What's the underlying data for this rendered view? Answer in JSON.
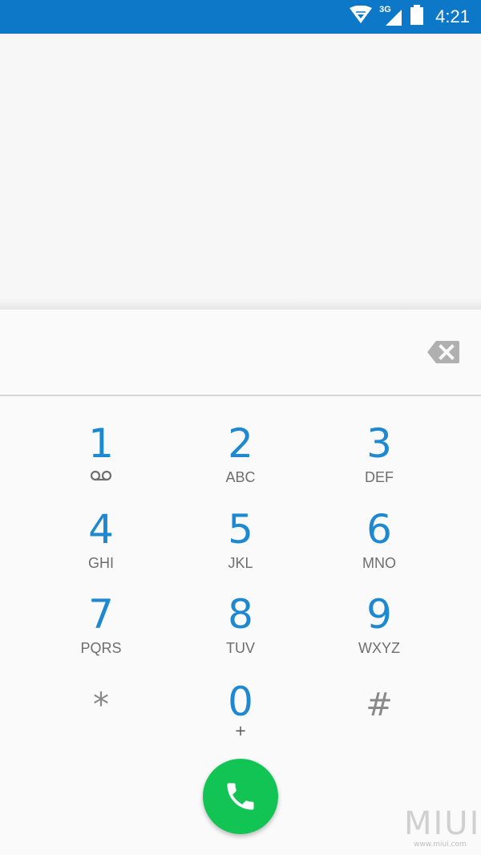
{
  "status_bar": {
    "network_type": "3G",
    "time": "4:21",
    "color": "#0d77c8"
  },
  "dialer": {
    "digits": "",
    "keys": [
      {
        "digit": "1",
        "letters": "",
        "icon": "voicemail-icon"
      },
      {
        "digit": "2",
        "letters": "ABC"
      },
      {
        "digit": "3",
        "letters": "DEF"
      },
      {
        "digit": "4",
        "letters": "GHI"
      },
      {
        "digit": "5",
        "letters": "JKL"
      },
      {
        "digit": "6",
        "letters": "MNO"
      },
      {
        "digit": "7",
        "letters": "PQRS"
      },
      {
        "digit": "8",
        "letters": "TUV"
      },
      {
        "digit": "9",
        "letters": "WXYZ"
      },
      {
        "digit": "*",
        "letters": ""
      },
      {
        "digit": "0",
        "letters": "+"
      },
      {
        "digit": "#",
        "letters": ""
      }
    ],
    "key_color": "#1e88d1",
    "call_button_color": "#12c454"
  },
  "watermark": {
    "logo": "MIUI",
    "url": "www.miui.com"
  }
}
